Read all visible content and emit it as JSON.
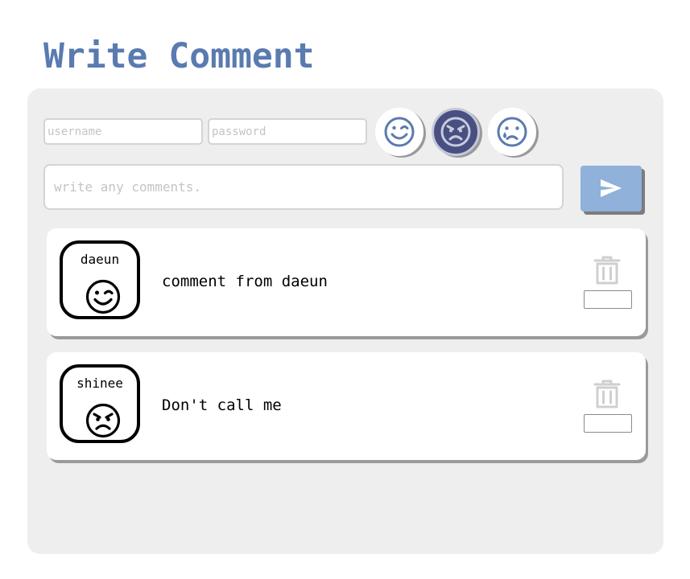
{
  "header": {
    "title": "Write Comment"
  },
  "form": {
    "username_placeholder": "username",
    "password_placeholder": "password",
    "comment_placeholder": "write any comments.",
    "emotions": [
      {
        "name": "wink",
        "icon": "wink-face-icon",
        "selected": false
      },
      {
        "name": "angry",
        "icon": "angry-face-icon",
        "selected": true
      },
      {
        "name": "sad",
        "icon": "sad-tear-face-icon",
        "selected": false
      }
    ],
    "send_icon": "send-icon"
  },
  "comments": [
    {
      "username": "daeun",
      "emotion_icon": "wink-face-icon",
      "text": "comment from daeun",
      "delete_icon": "trash-icon"
    },
    {
      "username": "shinee",
      "emotion_icon": "angry-face-icon",
      "text": "Don't call me",
      "delete_icon": "trash-icon"
    }
  ],
  "colors": {
    "title": "#5a7bb0",
    "panel": "#eeeeee",
    "selected_emotion": "#4a4f82",
    "send_button": "#8fb1da",
    "icon_blue": "#5a7bb0",
    "trash": "#cfcfcf"
  }
}
